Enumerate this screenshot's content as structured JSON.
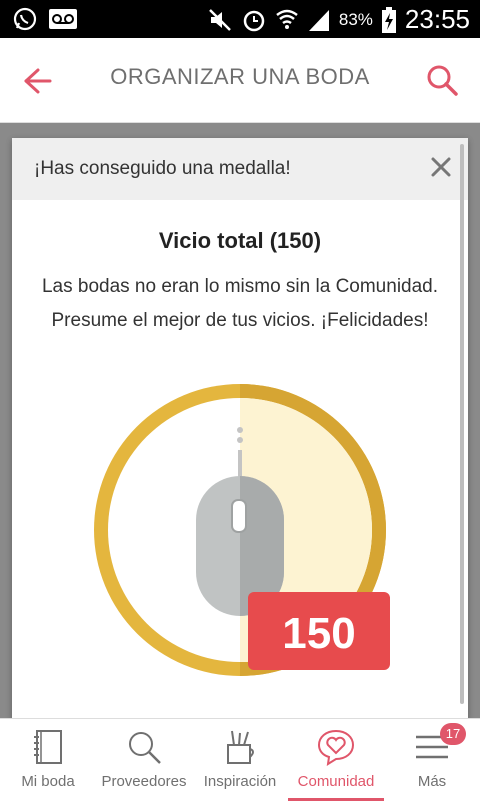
{
  "status_bar": {
    "battery": "83%",
    "time": "23:55"
  },
  "header": {
    "title": "ORGANIZAR UNA BODA"
  },
  "dialog": {
    "header": "¡Has conseguido una medalla!",
    "medal_title": "Vicio total (150)",
    "description": "Las bodas no eran lo mismo sin la Comunidad. Presume el mejor de tus vicios. ¡Felicidades!",
    "badge_count": "150"
  },
  "nav": {
    "items": [
      {
        "label": "Mi boda",
        "icon": "notebook-icon"
      },
      {
        "label": "Proveedores",
        "icon": "search-icon"
      },
      {
        "label": "Inspiración",
        "icon": "pencil-cup-icon"
      },
      {
        "label": "Comunidad",
        "icon": "heart-bubble-icon"
      },
      {
        "label": "Más",
        "icon": "menu-icon"
      }
    ],
    "more_badge": "17"
  },
  "colors": {
    "accent": "#e0566a",
    "medal_gold": "#e4b63e",
    "badge_red": "#e74b4d"
  }
}
